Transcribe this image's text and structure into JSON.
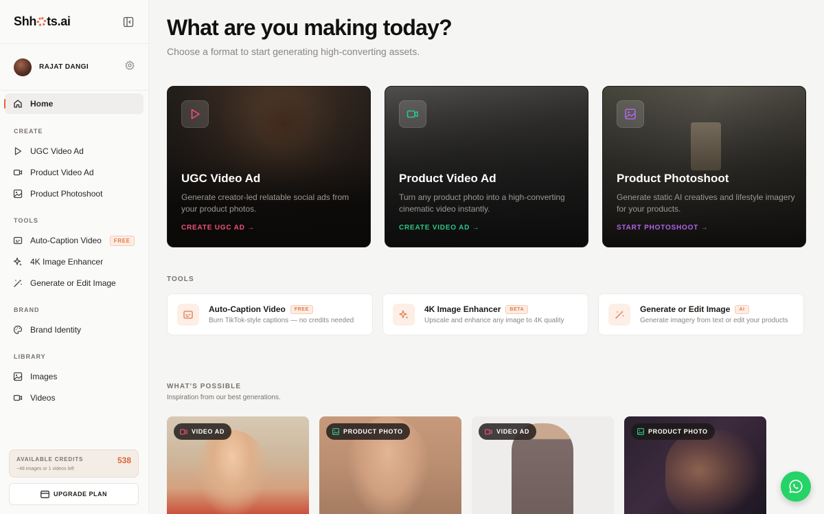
{
  "app": {
    "logo_text_before": "Shh",
    "logo_text_after": "ts.ai"
  },
  "user": {
    "name": "RAJAT DANGI"
  },
  "sidebar": {
    "home": "Home",
    "create_label": "CREATE",
    "create_items": [
      "UGC Video Ad",
      "Product Video Ad",
      "Product Photoshoot"
    ],
    "tools_label": "TOOLS",
    "tools_items": [
      "Auto-Caption Video",
      "4K Image Enhancer",
      "Generate or Edit Image"
    ],
    "tools_free_badge": "FREE",
    "brand_label": "BRAND",
    "brand_items": [
      "Brand Identity"
    ],
    "library_label": "LIBRARY",
    "library_items": [
      "Images",
      "Videos"
    ]
  },
  "credits": {
    "label": "AVAILABLE CREDITS",
    "value": "538",
    "sub": "~48 images or 1 videos left",
    "upgrade": "UPGRADE PLAN"
  },
  "main": {
    "title": "What are you making today?",
    "subtitle": "Choose a format to start generating high-converting assets.",
    "cards": [
      {
        "title": "UGC Video Ad",
        "desc": "Generate creator-led relatable social ads from your product photos.",
        "cta": "CREATE UGC AD →",
        "accent": "#f0507a"
      },
      {
        "title": "Product Video Ad",
        "desc": "Turn any product photo into a high-converting cinematic video instantly.",
        "cta": "CREATE VIDEO AD →",
        "accent": "#2fc58a"
      },
      {
        "title": "Product Photoshoot",
        "desc": "Generate static AI creatives and lifestyle imagery for your products.",
        "cta": "START PHOTOSHOOT →",
        "accent": "#b066e8"
      }
    ],
    "tools_label": "TOOLS",
    "tools": [
      {
        "title": "Auto-Caption Video",
        "badge": "FREE",
        "desc": "Burn TikTok-style captions — no credits needed"
      },
      {
        "title": "4K Image Enhancer",
        "badge": "BETA",
        "desc": "Upscale and enhance any image to 4K quality"
      },
      {
        "title": "Generate or Edit Image",
        "badge": "AI",
        "desc": "Generate imagery from text or edit your products"
      }
    ],
    "possible_label": "WHAT'S POSSIBLE",
    "possible_sub": "Inspiration from our best generations.",
    "gallery": [
      {
        "badge": "VIDEO AD",
        "icon": "video-icon"
      },
      {
        "badge": "PRODUCT PHOTO",
        "icon": "image-icon"
      },
      {
        "badge": "VIDEO AD",
        "icon": "video-icon"
      },
      {
        "badge": "PRODUCT PHOTO",
        "icon": "image-icon"
      }
    ]
  },
  "colors": {
    "accent": "#e8643a",
    "whatsapp": "#25d366"
  }
}
